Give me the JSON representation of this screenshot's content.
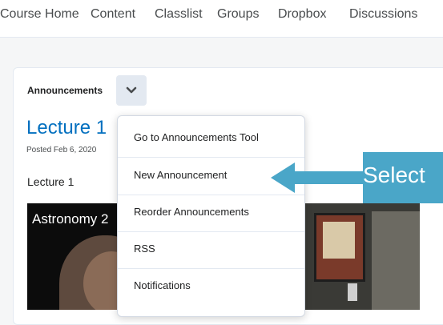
{
  "nav": {
    "items": [
      "Course Home",
      "Content",
      "Classlist",
      "Groups",
      "Dropbox",
      "Discussions"
    ]
  },
  "widget": {
    "title": "Announcements",
    "dropdown_icon": "chevron-down-icon",
    "lecture_title": "Lecture 1",
    "posted": "Posted Feb 6, 2020",
    "body": "Lecture 1",
    "video_title": "Astronomy 2"
  },
  "menu": {
    "items": [
      "Go to Announcements Tool",
      "New Announcement",
      "Reorder Announcements",
      "RSS",
      "Notifications"
    ]
  },
  "callout": {
    "text": "Select",
    "color": "#4aa6c8"
  },
  "colors": {
    "link": "#006fbf",
    "chevron_bg": "#e3e9f1"
  }
}
